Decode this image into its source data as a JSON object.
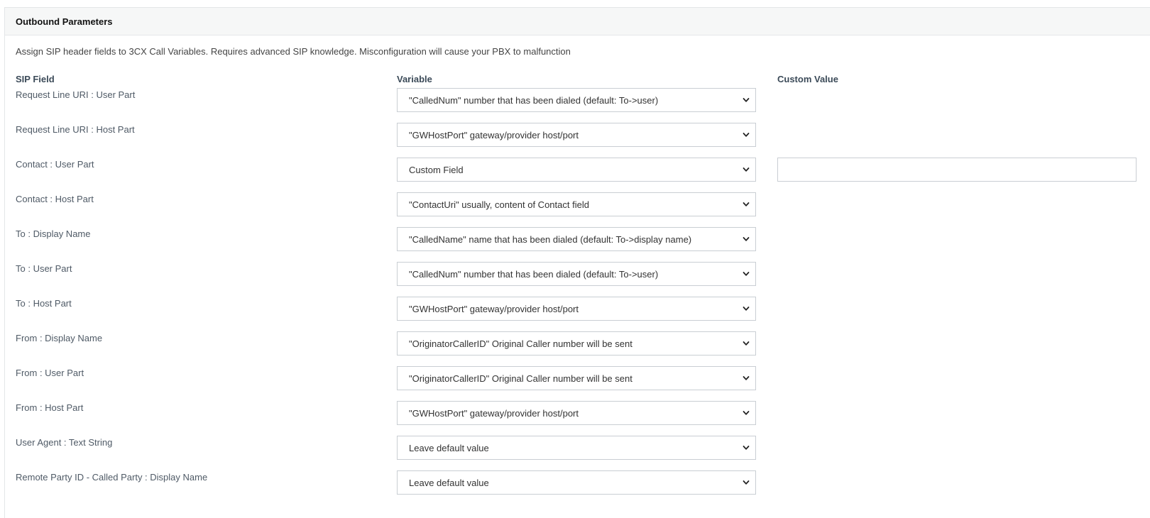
{
  "panel": {
    "title": "Outbound Parameters",
    "description": "Assign SIP header fields to 3CX Call Variables. Requires advanced SIP knowledge. Misconfiguration will cause your PBX to malfunction"
  },
  "columns": {
    "sip_field": "SIP Field",
    "variable": "Variable",
    "custom_value": "Custom Value"
  },
  "rows": [
    {
      "label": "Request Line URI : User Part",
      "variable": "\"CalledNum\" number that has been dialed (default: To->user)",
      "custom": null
    },
    {
      "label": "Request Line URI : Host Part",
      "variable": "\"GWHostPort\" gateway/provider host/port",
      "custom": null
    },
    {
      "label": "Contact : User Part",
      "variable": "Custom Field",
      "custom": ""
    },
    {
      "label": "Contact : Host Part",
      "variable": "\"ContactUri\" usually, content of Contact field",
      "custom": null
    },
    {
      "label": "To : Display Name",
      "variable": "\"CalledName\" name that has been dialed (default: To->display name)",
      "custom": null
    },
    {
      "label": "To : User Part",
      "variable": "\"CalledNum\" number that has been dialed (default: To->user)",
      "custom": null
    },
    {
      "label": "To : Host Part",
      "variable": "\"GWHostPort\" gateway/provider host/port",
      "custom": null
    },
    {
      "label": "From : Display Name",
      "variable": "\"OriginatorCallerID\" Original Caller number will be sent",
      "custom": null
    },
    {
      "label": "From : User Part",
      "variable": "\"OriginatorCallerID\" Original Caller number will be sent",
      "custom": null
    },
    {
      "label": "From : Host Part",
      "variable": "\"GWHostPort\" gateway/provider host/port",
      "custom": null
    },
    {
      "label": "User Agent : Text String",
      "variable": "Leave default value",
      "custom": null
    },
    {
      "label": "Remote Party ID - Called Party : Display Name",
      "variable": "Leave default value",
      "custom": null
    }
  ],
  "colors": {
    "header_bg": "#f6f7f7",
    "border": "#c9ced3",
    "label_text": "#4f5a66",
    "column_head_text": "#3b4a58"
  },
  "icons": {
    "select_arrow": "chevron-down-icon"
  }
}
